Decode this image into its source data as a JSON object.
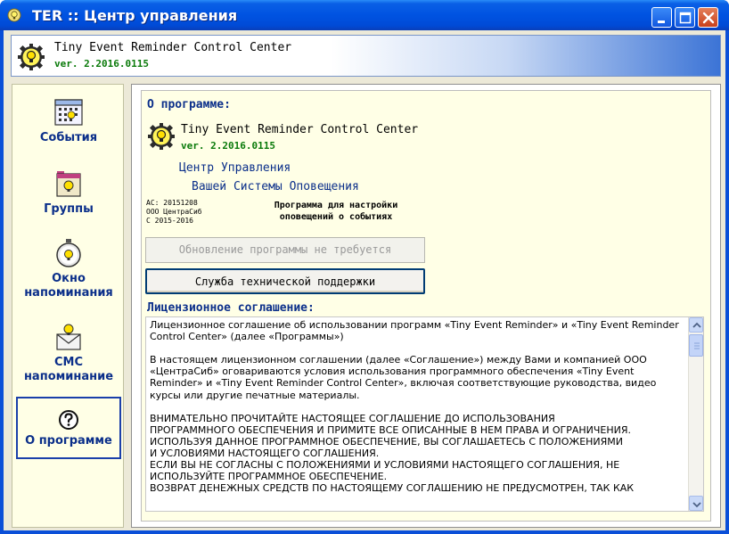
{
  "window": {
    "title": "TER :: Центр управления",
    "minimize_icon": "minimize-icon",
    "maximize_icon": "maximize-icon",
    "close_icon": "close-icon"
  },
  "header": {
    "app_name": "Tiny Event Reminder Control Center",
    "version": "ver. 2.2016.0115",
    "icon": "lightbulb-gear-icon"
  },
  "sidebar": {
    "items": [
      {
        "label": "События",
        "icon": "calendar-icon"
      },
      {
        "label": "Группы",
        "icon": "folder-icon"
      },
      {
        "label": "Окно напоминания",
        "icon": "stopwatch-icon"
      },
      {
        "label": "СМС напоминание",
        "icon": "sms-envelope-icon"
      },
      {
        "label": "О программе",
        "icon": "question-icon",
        "active": true
      }
    ]
  },
  "about": {
    "section_title": "О программе:",
    "app_name": "Tiny Event Reminder Control Center",
    "version": "ver. 2.2016.0115",
    "tagline_1": "Центр Управления",
    "tagline_2": "Вашей Системы Оповещения",
    "meta_ac": "AC: 20151208",
    "meta_org": "ООО ЦентраСиб",
    "meta_copy": "C 2015-2016",
    "description": "Программа для настройки оповещений о событиях",
    "update_button": "Обновление программы не требуется",
    "support_button": "Служба технической поддержки"
  },
  "license": {
    "section_title": "Лицензионное соглашение:",
    "p1": "Лицензионное соглашение об использовании программ «Tiny Event Reminder» и «Tiny Event Reminder Control Center» (далее «Программы»)",
    "p2": "В настоящем лицензионном соглашении (далее «Соглашение») между Вами и  компанией ООО «ЦентраСиб» оговариваются условия использования программного обеспечения «Tiny Event Reminder» и «Tiny Event Reminder Control Center», включая соответствующие руководства, видео курсы или другие печатные материалы.",
    "p3": "ВНИМАТЕЛЬНО ПРОЧИТАЙТЕ НАСТОЯЩЕЕ СОГЛАШЕНИЕ ДО ИСПОЛЬЗОВАНИЯ\nПРОГРАММНОГО ОБЕСПЕЧЕНИЯ И ПРИМИТЕ ВСЕ ОПИСАННЫЕ В НЕМ ПРАВА И ОГРАНИЧЕНИЯ.\nИСПОЛЬЗУЯ ДАННОЕ ПРОГРАММНОЕ ОБЕСПЕЧЕНИЕ, ВЫ СОГЛАШАЕТЕСЬ С ПОЛОЖЕНИЯМИ\nИ УСЛОВИЯМИ НАСТОЯЩЕГО СОГЛАШЕНИЯ.\nЕСЛИ ВЫ НЕ СОГЛАСНЫ С ПОЛОЖЕНИЯМИ И УСЛОВИЯМИ НАСТОЯЩЕГО СОГЛАШЕНИЯ, НЕ\nИСПОЛЬЗУЙТЕ ПРОГРАММНОЕ ОБЕСПЕЧЕНИЕ.\nВОЗВРАТ ДЕНЕЖНЫХ СРЕДСТВ ПО НАСТОЯЩЕМУ СОГЛАШЕНИЮ НЕ ПРЕДУСМОТРЕН, ТАК КАК"
  },
  "colors": {
    "titlebar": "#0053e1",
    "sidebar_bg": "#ffffe6",
    "nav_text": "#0b2f8a",
    "version_green": "#0a7a0a",
    "window_face": "#ece9d8"
  }
}
